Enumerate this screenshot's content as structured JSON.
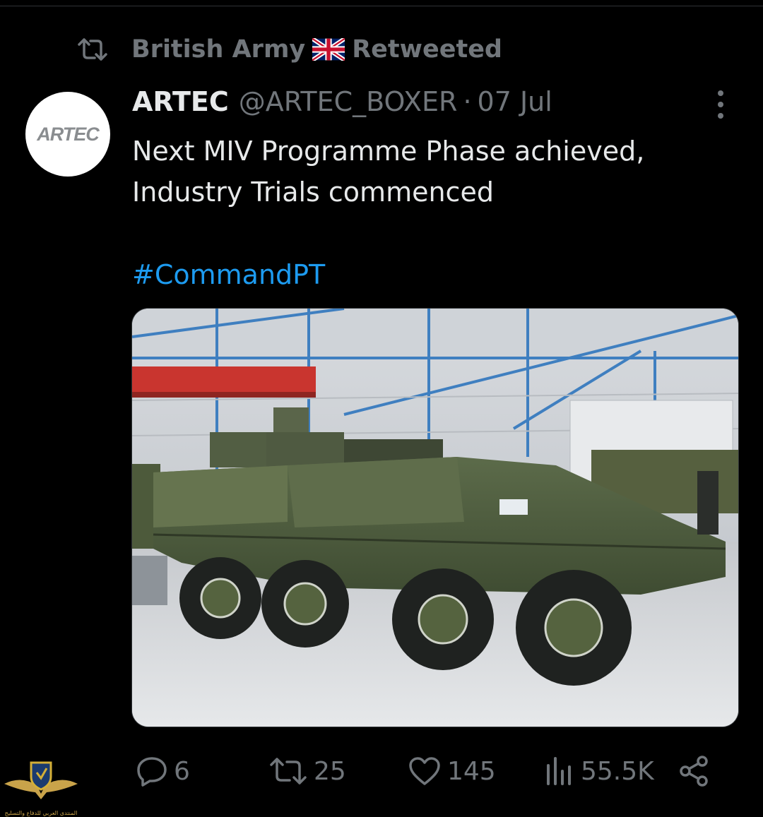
{
  "retweet": {
    "account": "British Army",
    "flag_icon": "uk-flag-icon",
    "label": "Retweeted"
  },
  "tweet": {
    "avatar_text": "ARTEC",
    "author_name": "ARTEC",
    "author_handle": "@ARTEC_BOXER",
    "separator": "·",
    "date": "07 Jul",
    "text_line1": "Next MIV Programme Phase achieved,",
    "text_line2": "Industry Trials commenced",
    "hashtag": "#CommandPT"
  },
  "actions": {
    "replies": "6",
    "retweets": "25",
    "likes": "145",
    "views": "55.5K"
  },
  "watermark": {
    "text": "المنتدى العربي للدفاع والتسليح"
  },
  "colors": {
    "background": "#000000",
    "text": "#e7e9ea",
    "secondary": "#71767b",
    "link": "#1d9bf0"
  }
}
